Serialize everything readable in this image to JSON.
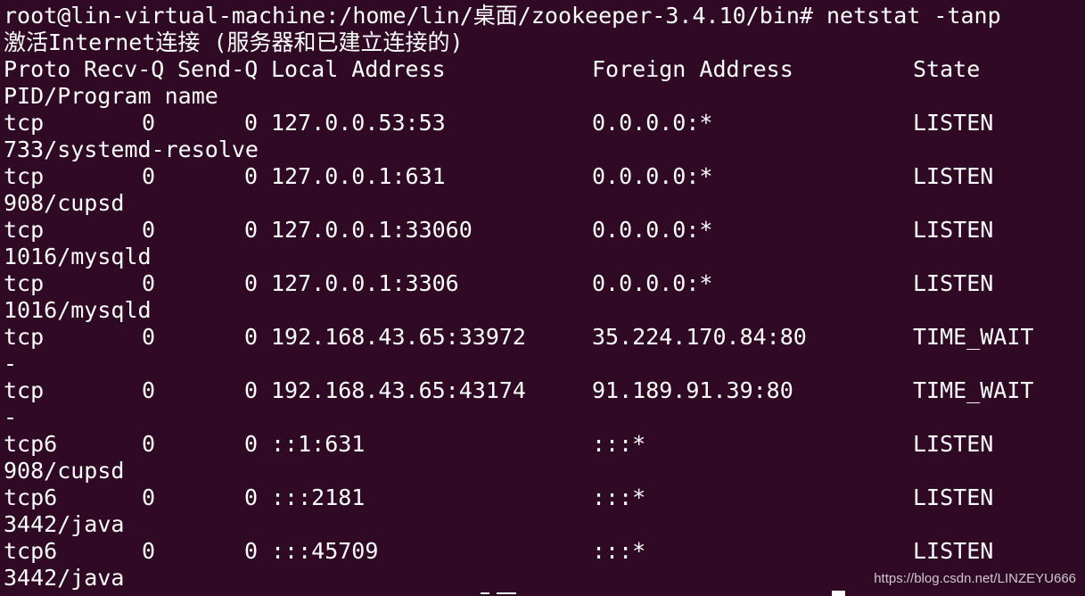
{
  "prompt": {
    "text": "root@lin-virtual-machine:/home/lin/桌面/zookeeper-3.4.10/bin# netstat -tanp"
  },
  "output": {
    "title": "激活Internet连接 (服务器和已建立连接的)",
    "headers": {
      "proto": "Proto",
      "recv_q": "Recv-Q",
      "send_q": "Send-Q",
      "local_address": "Local Address",
      "foreign_address": "Foreign Address",
      "state": "State",
      "pid_program": "PID/Program name"
    },
    "rows": [
      {
        "proto": "tcp",
        "recv_q": "0",
        "send_q": "0",
        "local": "127.0.0.53:53",
        "foreign": "0.0.0.0:*",
        "state": "LISTEN",
        "pid": "733/systemd-resolve"
      },
      {
        "proto": "tcp",
        "recv_q": "0",
        "send_q": "0",
        "local": "127.0.0.1:631",
        "foreign": "0.0.0.0:*",
        "state": "LISTEN",
        "pid": "908/cupsd"
      },
      {
        "proto": "tcp",
        "recv_q": "0",
        "send_q": "0",
        "local": "127.0.0.1:33060",
        "foreign": "0.0.0.0:*",
        "state": "LISTEN",
        "pid": "1016/mysqld"
      },
      {
        "proto": "tcp",
        "recv_q": "0",
        "send_q": "0",
        "local": "127.0.0.1:3306",
        "foreign": "0.0.0.0:*",
        "state": "LISTEN",
        "pid": "1016/mysqld"
      },
      {
        "proto": "tcp",
        "recv_q": "0",
        "send_q": "0",
        "local": "192.168.43.65:33972",
        "foreign": "35.224.170.84:80",
        "state": "TIME_WAIT",
        "pid": "-"
      },
      {
        "proto": "tcp",
        "recv_q": "0",
        "send_q": "0",
        "local": "192.168.43.65:43174",
        "foreign": "91.189.91.39:80",
        "state": "TIME_WAIT",
        "pid": "-"
      },
      {
        "proto": "tcp6",
        "recv_q": "0",
        "send_q": "0",
        "local": "::1:631",
        "foreign": ":::*",
        "state": "LISTEN",
        "pid": "908/cupsd"
      },
      {
        "proto": "tcp6",
        "recv_q": "0",
        "send_q": "0",
        "local": ":::2181",
        "foreign": ":::*",
        "state": "LISTEN",
        "pid": "3442/java"
      },
      {
        "proto": "tcp6",
        "recv_q": "0",
        "send_q": "0",
        "local": ":::45709",
        "foreign": ":::*",
        "state": "LISTEN",
        "pid": "3442/java"
      }
    ]
  },
  "watermark": {
    "text": "https://blog.csdn.net/LINZEYU666"
  },
  "colors": {
    "background": "#300a24",
    "foreground": "#ffffff"
  }
}
